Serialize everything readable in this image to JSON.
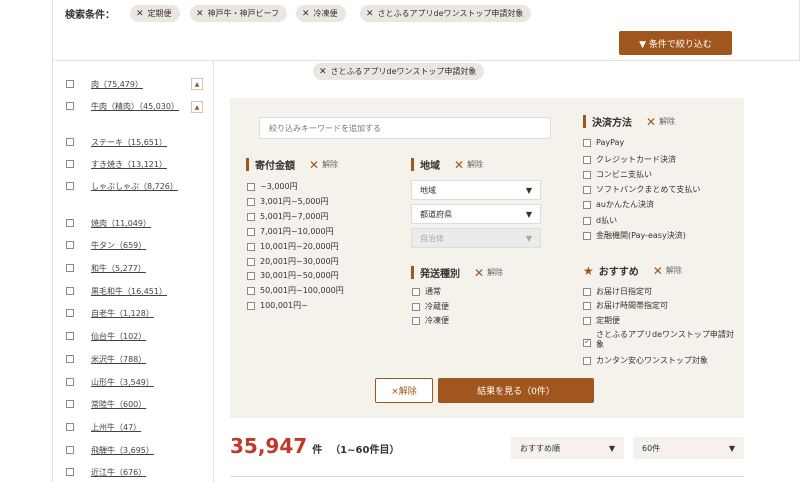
{
  "search_conditions": {
    "label": "検索条件：",
    "chips": [
      "定期便",
      "神戸牛・神戸ビーフ",
      "冷凍便",
      "さとふるアプリdeワンストップ申請対象"
    ],
    "filter_button": "▼ 条件で絞り込む"
  },
  "sub_chip": "さとふるアプリdeワンストップ申請対象",
  "sidebar": {
    "items": [
      {
        "label": "肉（75,479）",
        "expand": "▲"
      },
      {
        "label": "牛肉（精肉）（45,030）",
        "expand": "▲"
      },
      {
        "label": "ステーキ（15,651）"
      },
      {
        "label": "すき焼き（13,121）"
      },
      {
        "label": "しゃぶしゃぶ（8,726）"
      },
      {
        "label": "焼肉（11,049）"
      },
      {
        "label": "牛タン（659）"
      },
      {
        "label": "和牛（5,277）"
      },
      {
        "label": "黒毛和牛（16,451）"
      },
      {
        "label": "自老牛（1,128）"
      },
      {
        "label": "仙台牛（102）"
      },
      {
        "label": "米沢牛（788）"
      },
      {
        "label": "山形牛（3,549）"
      },
      {
        "label": "常陸牛（600）"
      },
      {
        "label": "上州牛（47）"
      },
      {
        "label": "飛騨牛（3,695）"
      },
      {
        "label": "近江牛（676）"
      }
    ]
  },
  "panel": {
    "keyword_placeholder": "絞り込みキーワードを追加する",
    "clear_label": "解除",
    "donation": {
      "title": "寄付金額",
      "options": [
        "~3,000円",
        "3,001円~5,000円",
        "5,001円~7,000円",
        "7,001円~10,000円",
        "10,001円~20,000円",
        "20,001円~30,000円",
        "30,001円~50,000円",
        "50,001円~100,000円",
        "100,001円~"
      ]
    },
    "region": {
      "title": "地域",
      "select_region": "地域",
      "select_pref": "都道府県",
      "select_city": "自治体"
    },
    "shipping": {
      "title": "発送種別",
      "options": [
        "通常",
        "冷蔵便",
        "冷凍便"
      ]
    },
    "payment": {
      "title": "決済方法",
      "options": [
        "PayPay",
        "クレジットカード決済",
        "コンビニ支払い",
        "ソフトバンクまとめて支払い",
        "auかんたん決済",
        "d払い",
        "金融機関(Pay-easy決済)"
      ]
    },
    "recommend": {
      "title": "おすすめ",
      "options": [
        {
          "label": "お届け日指定可",
          "checked": false
        },
        {
          "label": "お届け時間帯指定可",
          "checked": false
        },
        {
          "label": "定期便",
          "checked": false
        },
        {
          "label": "さとふるアプリdeワンストップ申請対象",
          "checked": true
        },
        {
          "label": "カンタン安心ワンストップ対象",
          "checked": false
        }
      ]
    },
    "clear_button": "×解除",
    "result_button": "結果を見る（0件）"
  },
  "results": {
    "count": "35,947",
    "unit": "件",
    "range": "（1~60件目）",
    "sort": "おすすめ順",
    "per_page": "60件"
  },
  "colors": {
    "accent": "#a0561c",
    "count": "#c0392b",
    "panel_bg": "#f5f1eb"
  }
}
